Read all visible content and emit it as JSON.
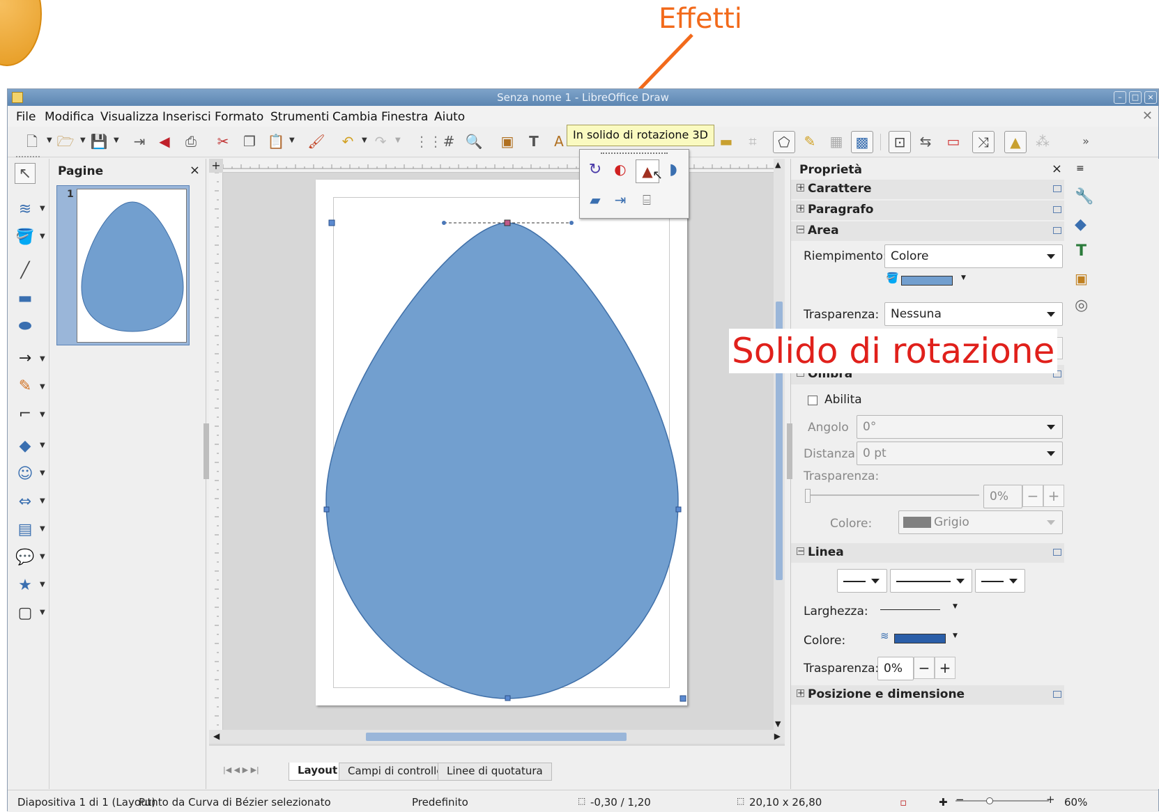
{
  "annotations": {
    "effects_label": "Effetti",
    "rotation_label": "Solido di rotazione",
    "effects_color": "#f26a1b",
    "rotation_color": "#e0201b"
  },
  "window": {
    "title": "Senza nome 1 - LibreOffice Draw",
    "menu": [
      "File",
      "Modifica",
      "Visualizza",
      "Inserisci",
      "Formato",
      "Strumenti",
      "Cambia",
      "Finestra",
      "Aiuto"
    ]
  },
  "tooltip": "In solido di rotazione 3D",
  "pages_panel": {
    "title": "Pagine",
    "close": "×",
    "page_number": "1"
  },
  "properties": {
    "title": "Proprietà",
    "close": "×",
    "sections": {
      "character": "Carattere",
      "paragraph": "Paragrafo",
      "area": "Area",
      "shadow": "Ombra",
      "line": "Linea",
      "position": "Posizione e dimensione"
    },
    "area": {
      "fill_label": "Riempimento:",
      "fill_value": "Colore",
      "transparency_label": "Trasparenza:",
      "transparency_value": "Nessuna",
      "fill_color": "#729fcf"
    },
    "shadow": {
      "enable_label": "Abilita",
      "angle_label": "Angolo",
      "angle_value": "0°",
      "distance_label": "Distanza",
      "distance_value": "0 pt",
      "transparency_label": "Trasparenza:",
      "transparency_value": "0%",
      "color_label": "Colore:",
      "color_value": "Grigio"
    },
    "line": {
      "width_label": "Larghezza:",
      "color_label": "Colore:",
      "transparency_label": "Trasparenza:",
      "transparency_value": "0%",
      "line_color": "#2a5ea8"
    },
    "minus": "−",
    "plus": "+"
  },
  "tabs": [
    "Layout",
    "Campi di controllo",
    "Linee di quotatura"
  ],
  "status": {
    "slide": "Diapositiva 1 di 1 (Layout)",
    "selection": "Punto da Curva di Bézier selezionato",
    "style": "Predefinito",
    "position": "-0,30 / 1,20",
    "size": "20,10 x 26,80",
    "zoom": "60%"
  },
  "colors": {
    "shape": "#729fcf",
    "shape_stroke": "#3f6fa8",
    "titlebar": "#6b93bd"
  }
}
